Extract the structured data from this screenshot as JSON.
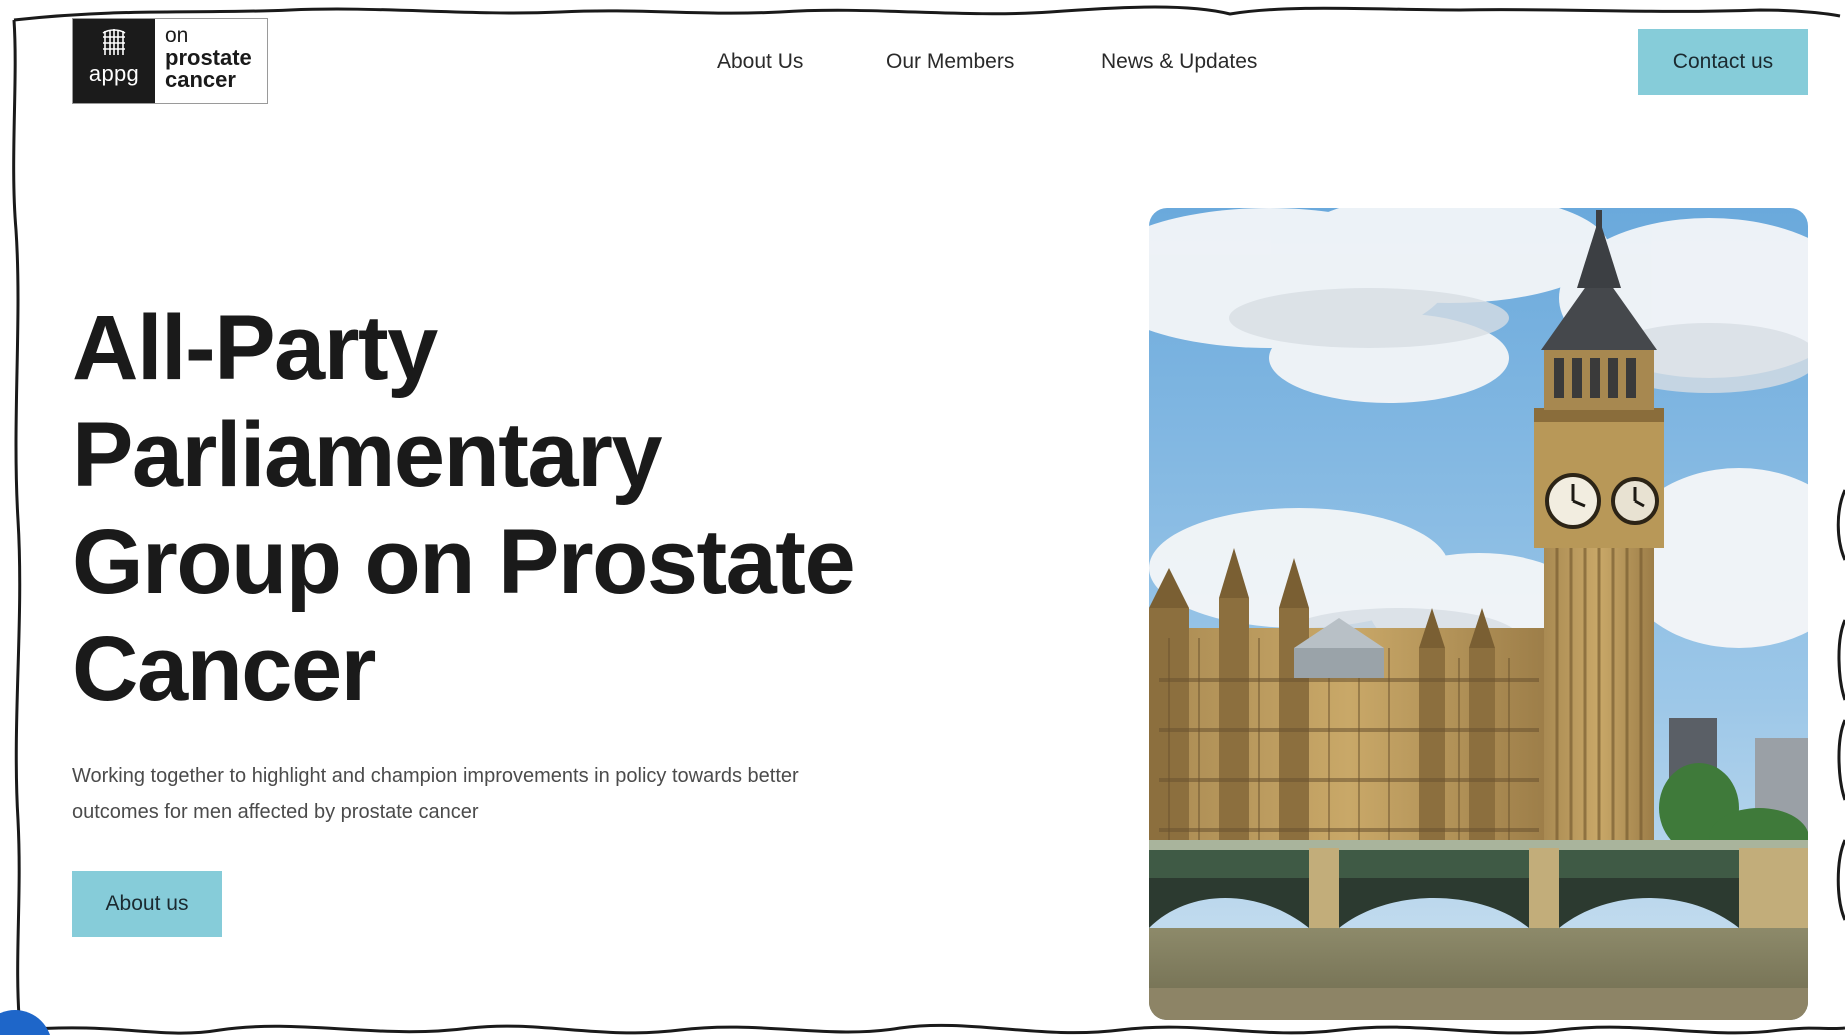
{
  "logo": {
    "badge_text": "appg",
    "line_on": "on",
    "line_prostate": "prostate",
    "line_cancer": "cancer",
    "icon": "portcullis-icon"
  },
  "nav": {
    "items": [
      {
        "label": "About Us"
      },
      {
        "label": "Our Members"
      },
      {
        "label": "News & Updates"
      }
    ],
    "contact_label": "Contact us"
  },
  "hero": {
    "title_lines": [
      "All-Party",
      "Parliamentary",
      "Group on Prostate",
      "Cancer"
    ],
    "subtitle_lines": [
      "Working together to highlight and champion improvements in policy towards better",
      "outcomes for men affected by prostate cancer"
    ],
    "cta_label": "About us",
    "image_subject": "big-ben-westminster-photo"
  },
  "colors": {
    "accent": "#86ccd9",
    "text": "#1a1a1a",
    "muted": "#4b4b4b",
    "logo_dark": "#1b1b1b"
  }
}
